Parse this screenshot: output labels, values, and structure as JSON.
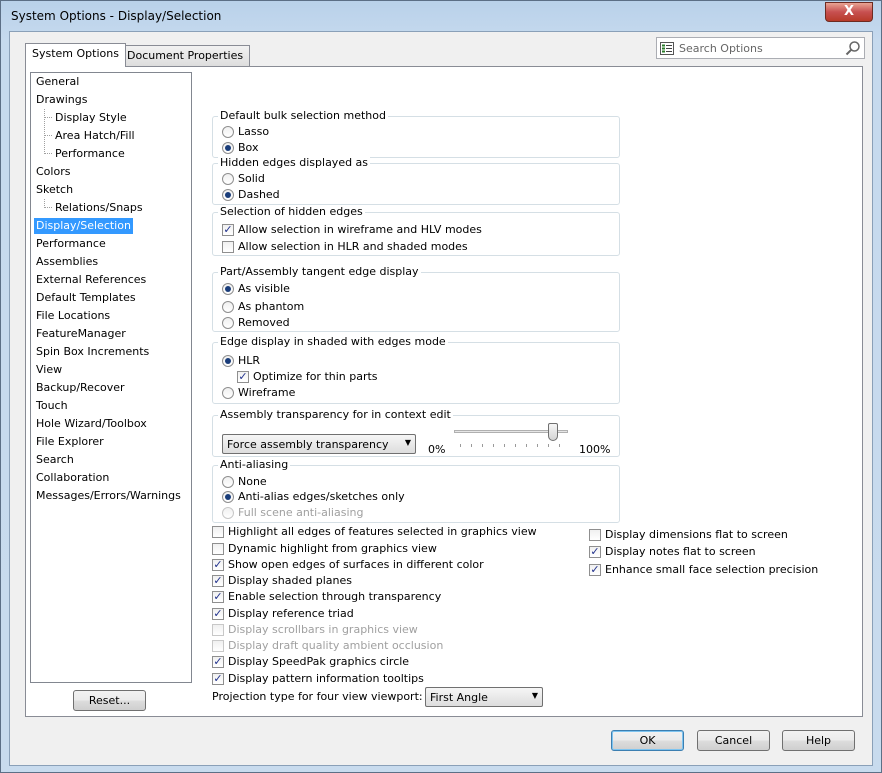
{
  "window": {
    "title": "System Options - Display/Selection",
    "close_label": "X"
  },
  "tabs": [
    {
      "label": "System Options"
    },
    {
      "label": "Document Properties"
    }
  ],
  "search": {
    "placeholder": "Search Options"
  },
  "tree": [
    "General",
    "Drawings",
    "Display Style",
    "Area Hatch/Fill",
    "Performance",
    "Colors",
    "Sketch",
    "Relations/Snaps",
    "Display/Selection",
    "Performance",
    "Assemblies",
    "External References",
    "Default Templates",
    "File Locations",
    "FeatureManager",
    "Spin Box Increments",
    "View",
    "Backup/Recover",
    "Touch",
    "Hole Wizard/Toolbox",
    "File Explorer",
    "Search",
    "Collaboration",
    "Messages/Errors/Warnings"
  ],
  "groups": {
    "bulk": {
      "title": "Default bulk selection method",
      "options": [
        "Lasso",
        "Box"
      ],
      "selected": "Box"
    },
    "hidden": {
      "title": "Hidden edges displayed as",
      "options": [
        "Solid",
        "Dashed"
      ],
      "selected": "Dashed"
    },
    "sel_hidden": {
      "title": "Selection of hidden edges",
      "options": [
        "Allow selection in wireframe and HLV modes",
        "Allow selection in HLR and shaded modes"
      ],
      "checked": [
        true,
        false
      ]
    },
    "tangent": {
      "title": "Part/Assembly tangent edge display",
      "options": [
        "As visible",
        "As phantom",
        "Removed"
      ],
      "selected": "As visible"
    },
    "edge_shaded": {
      "title": "Edge display in shaded with edges mode",
      "hlr": "HLR",
      "optimize": "Optimize for thin parts",
      "optimize_checked": true,
      "wireframe": "Wireframe",
      "selected": "HLR"
    },
    "transparency": {
      "title": "Assembly transparency for in context edit",
      "combo": "Force assembly transparency",
      "min": "0%",
      "max": "100%",
      "value_pct": 90
    },
    "aa": {
      "title": "Anti-aliasing",
      "options": [
        "None",
        "Anti-alias edges/sketches only",
        "Full scene anti-aliasing"
      ],
      "selected": "Anti-alias edges/sketches only"
    }
  },
  "checks_left": [
    {
      "label": "Highlight all edges of features selected in graphics view",
      "checked": false,
      "enabled": true
    },
    {
      "label": "Dynamic highlight from graphics view",
      "checked": false,
      "enabled": true
    },
    {
      "label": "Show open edges of surfaces in different color",
      "checked": true,
      "enabled": true
    },
    {
      "label": "Display shaded planes",
      "checked": true,
      "enabled": true
    },
    {
      "label": "Enable selection through transparency",
      "checked": true,
      "enabled": true
    },
    {
      "label": "Display reference triad",
      "checked": true,
      "enabled": true
    },
    {
      "label": "Display scrollbars in graphics view",
      "checked": false,
      "enabled": false
    },
    {
      "label": "Display draft quality ambient occlusion",
      "checked": false,
      "enabled": false
    },
    {
      "label": "Display SpeedPak graphics circle",
      "checked": true,
      "enabled": true
    },
    {
      "label": "Display pattern information tooltips",
      "checked": true,
      "enabled": true
    }
  ],
  "checks_right": [
    {
      "label": "Display dimensions flat to screen",
      "checked": false
    },
    {
      "label": "Display notes flat to screen",
      "checked": true
    },
    {
      "label": "Enhance small face selection precision",
      "checked": true
    }
  ],
  "projection": {
    "label": "Projection type for four view viewport:",
    "value": "First Angle"
  },
  "buttons": {
    "reset": "Reset...",
    "ok": "OK",
    "cancel": "Cancel",
    "help": "Help"
  },
  "check_glyph": "✓"
}
